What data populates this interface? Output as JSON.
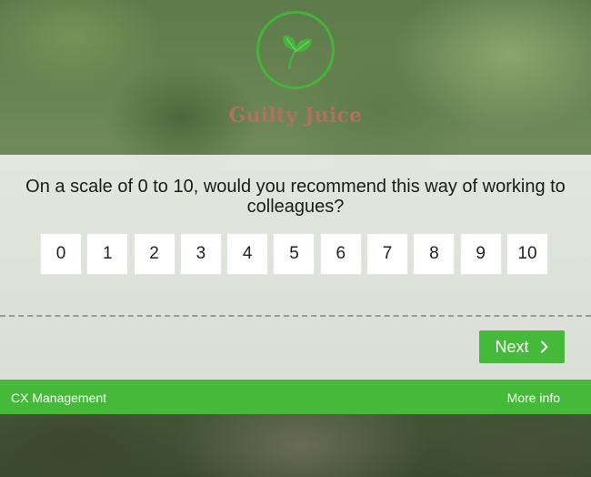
{
  "brand": {
    "name": "Guilty Juice",
    "logo_icon": "leaf-icon",
    "accent_color": "#45b93a",
    "name_color": "#b0705e"
  },
  "survey": {
    "question": "On a scale of 0 to 10, would you recommend this way of working to colleagues?",
    "scale_options": [
      "0",
      "1",
      "2",
      "3",
      "4",
      "5",
      "6",
      "7",
      "8",
      "9",
      "10"
    ],
    "next_label": "Next",
    "next_icon": "chevron-right-icon"
  },
  "footer": {
    "left_label": "CX Management",
    "right_label": "More info"
  }
}
